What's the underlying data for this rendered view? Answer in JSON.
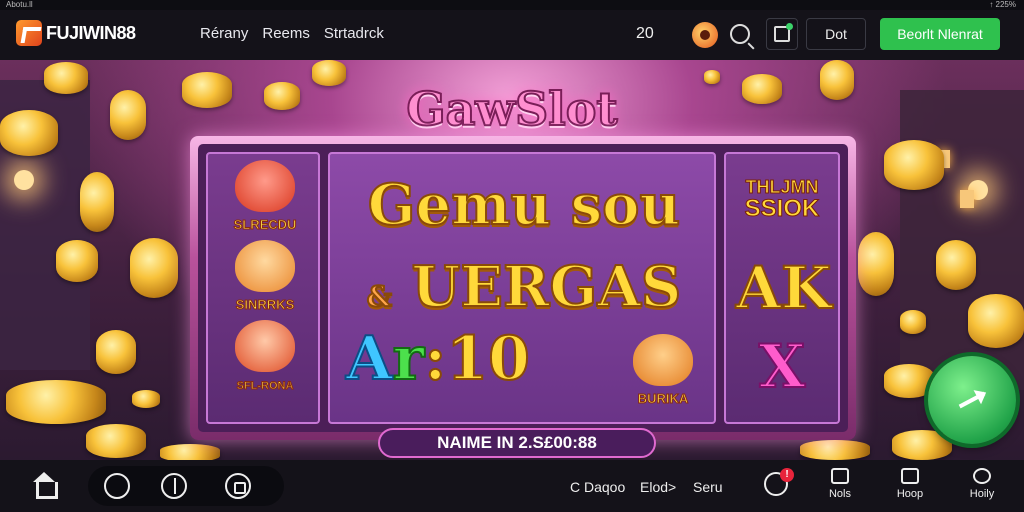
{
  "status": {
    "left": "Abotu.ll",
    "right": "↑ 225%"
  },
  "header": {
    "logo_text": "FUJIWIN88",
    "nav": [
      "Rérany",
      "Reems",
      "Strtadrck"
    ],
    "count": "20",
    "dot_button": "Dot",
    "cta_button": "Beorlt Nlenrat"
  },
  "game": {
    "title": "GawSlot",
    "left_reel": [
      "SLRECDU",
      "SINRRKS",
      "SFL-RONA"
    ],
    "center_line1": "Gemu sou",
    "center_line2_amp": "&",
    "center_line2": "UERGAS",
    "center_line3": [
      "A",
      "r",
      ":10"
    ],
    "center_cat_label": "BURIKA",
    "right_reel": {
      "top_line1": "THLJMN",
      "top_line2": "SSIOK",
      "mid": "AK",
      "bottom": "X"
    },
    "banner": "NAIME IN 2.S£00:88"
  },
  "bottom_bar": {
    "links": [
      "C Daqoo",
      "Elod>",
      "Seru"
    ],
    "bell_badge": "!",
    "tabs": [
      "Nols",
      "Hoop",
      "Hoily"
    ]
  },
  "colors": {
    "cta": "#2fc14e",
    "accent": "#ff9a2e",
    "badge": "#e8243b"
  }
}
